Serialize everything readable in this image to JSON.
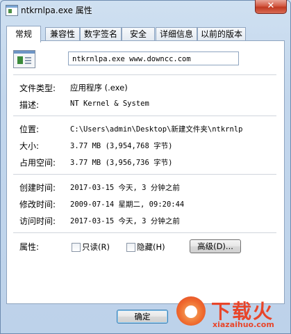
{
  "window": {
    "title": "ntkrnlpa.exe 属性",
    "close_glyph": "✕"
  },
  "tabs": [
    {
      "label": "常规",
      "active": true
    },
    {
      "label": "兼容性"
    },
    {
      "label": "数字签名"
    },
    {
      "label": "安全"
    },
    {
      "label": "详细信息"
    },
    {
      "label": "以前的版本"
    }
  ],
  "general": {
    "file_name": "ntkrnlpa.exe www.downcc.com",
    "file_type_label": "文件类型:",
    "file_type_value": "应用程序 (.exe)",
    "description_label": "描述:",
    "description_value": "NT Kernel & System",
    "location_label": "位置:",
    "location_value": "C:\\Users\\admin\\Desktop\\新建文件夹\\ntkrnlp",
    "size_label": "大小:",
    "size_value": "3.77 MB (3,954,768 字节)",
    "size_on_disk_label": "占用空间:",
    "size_on_disk_value": "3.77 MB (3,956,736 字节)",
    "created_label": "创建时间:",
    "created_value": "2017-03-15 今天, 3 分钟之前",
    "modified_label": "修改时间:",
    "modified_value": "2009-07-14 星期二, 09:20:44",
    "accessed_label": "访问时间:",
    "accessed_value": "2017-03-15 今天, 3 分钟之前",
    "attributes_label": "属性:",
    "readonly_label": "只读(R)",
    "hidden_label": "隐藏(H)",
    "advanced_button": "高级(D)..."
  },
  "buttons": {
    "ok": "确定"
  },
  "watermark": {
    "brand": "下载火",
    "url": "xiazaihuo.com",
    "color": "#e8452a"
  }
}
